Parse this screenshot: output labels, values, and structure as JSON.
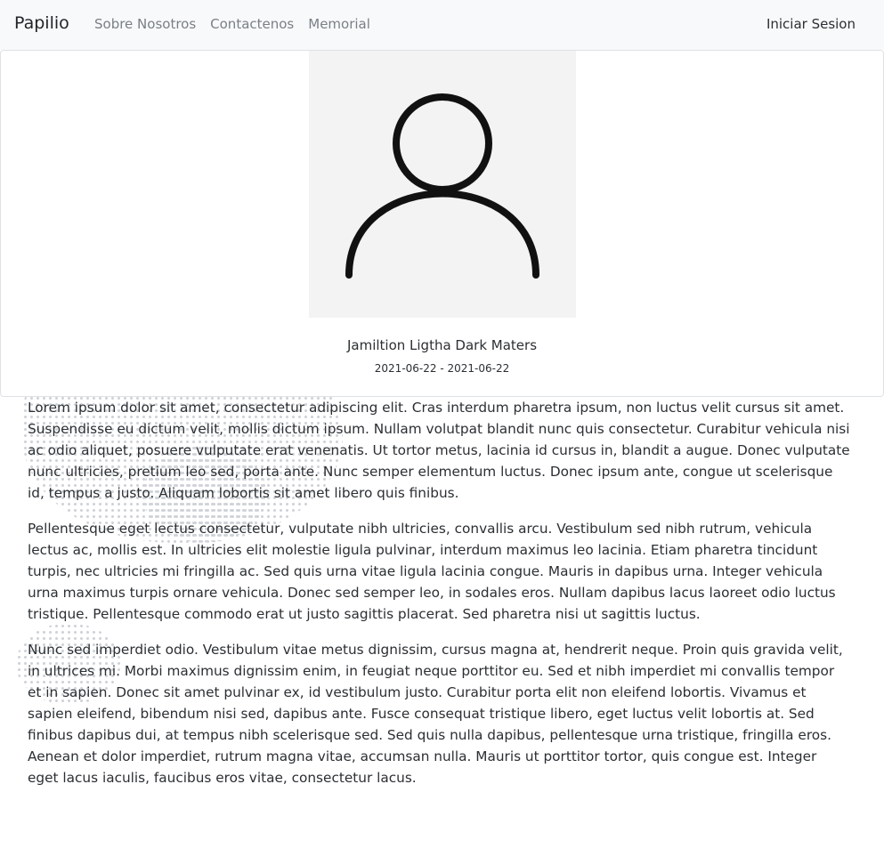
{
  "navbar": {
    "brand": "Papilio",
    "links": [
      "Sobre Nosotros",
      "Contactenos",
      "Memorial"
    ],
    "login_label": "Iniciar Sesion"
  },
  "profile": {
    "photo_icon": "user-silhouette-icon",
    "name": "Jamiltion Ligtha Dark Maters",
    "dates": "2021-06-22 - 2021-06-22"
  },
  "biography": {
    "paragraphs": [
      "Lorem ipsum dolor sit amet, consectetur adipiscing elit. Cras interdum pharetra ipsum, non luctus velit cursus sit amet. Suspendisse eu dictum velit, mollis dictum ipsum. Nullam volutpat blandit nunc quis consectetur. Curabitur vehicula nisi ac odio aliquet, posuere vulputate erat venenatis. Ut tortor metus, lacinia id cursus in, blandit a augue. Donec vulputate nunc ultricies, pretium leo sed, porta ante. Nunc semper elementum luctus. Donec ipsum ante, congue ut scelerisque id, tempus a justo. Aliquam lobortis sit amet libero quis finibus.",
      "Pellentesque eget lectus consectetur, vulputate nibh ultricies, convallis arcu. Vestibulum sed nibh rutrum, vehicula lectus ac, mollis est. In ultricies elit molestie ligula pulvinar, interdum maximus leo lacinia. Etiam pharetra tincidunt turpis, nec ultricies mi fringilla ac. Sed quis urna vitae ligula lacinia congue. Mauris in dapibus urna. Integer vehicula urna maximus turpis ornare vehicula. Donec sed semper leo, in sodales eros. Nullam dapibus lacus laoreet odio luctus tristique. Pellentesque commodo erat ut justo sagittis placerat. Sed pharetra nisi ut sagittis luctus.",
      "Nunc sed imperdiet odio. Vestibulum vitae metus dignissim, cursus magna at, hendrerit neque. Proin quis gravida velit, in ultrices mi. Morbi maximus dignissim enim, in feugiat neque porttitor eu. Sed et nibh imperdiet mi convallis tempor et in sapien. Donec sit amet pulvinar ex, id vestibulum justo. Curabitur porta elit non eleifend lobortis. Vivamus et sapien eleifend, bibendum nisi sed, dapibus ante. Fusce consequat tristique libero, eget luctus velit lobortis at. Sed finibus dapibus dui, at tempus nibh scelerisque sed. Sed quis nulla dapibus, pellentesque urna tristique, fringilla eros. Aenean et dolor imperdiet, rutrum magna vitae, accumsan nulla. Mauris ut porttitor tortor, quis congue est. Integer eget lacus iaculis, faucibus eros vitae, consectetur lacus."
    ]
  },
  "colors": {
    "navbar_bg": "#f8f9fa",
    "nav_link": "#7a7f86",
    "text": "#2b2f33",
    "photo_bg": "#f3f3f3"
  }
}
